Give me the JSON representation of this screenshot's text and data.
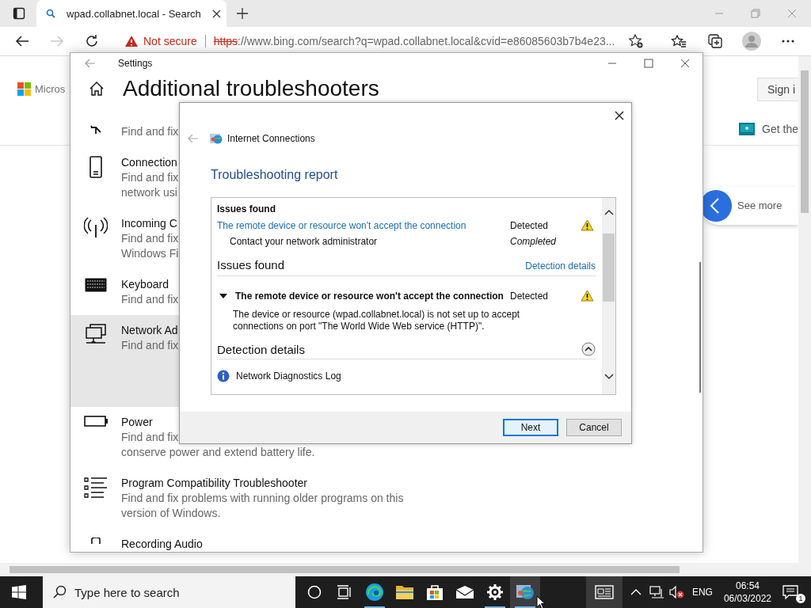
{
  "browser": {
    "tabs": [
      {
        "title": "wpad.collabnet.local - Search",
        "selected": true
      }
    ],
    "security": "Not secure",
    "url_scheme": "https",
    "url_rest": "://www.bing.com/search?q=wpad.collabnet.local&cvid=e86085603b7b4e23..."
  },
  "page": {
    "logo_text": "Micros",
    "sign_in": "Sign i",
    "promo": "Get the",
    "see_more": "See more"
  },
  "settings": {
    "title": "Settings",
    "heading": "Additional troubleshooters",
    "items": [
      {
        "lines": [
          "Find and fix"
        ],
        "selected": false
      },
      {
        "title": "Connection",
        "lines": [
          "Find and fix",
          "network usi"
        ],
        "selected": false
      },
      {
        "title": "Incoming C",
        "lines": [
          "Find and fix",
          "Windows Fi"
        ],
        "selected": false
      },
      {
        "title": "Keyboard",
        "lines": [
          "Find and fix"
        ],
        "selected": false
      },
      {
        "title": "Network Ad",
        "lines": [
          "Find and fix"
        ],
        "selected": true
      },
      {
        "title": "Power",
        "lines": [
          "Find and fix",
          "conserve power and extend battery life."
        ],
        "selected": false
      },
      {
        "title": "Program Compatibility Troubleshooter",
        "lines": [
          "Find and fix problems with running older programs on this",
          "version of Windows."
        ],
        "selected": false
      },
      {
        "title": "Recording Audio",
        "selected": false
      }
    ]
  },
  "dialog": {
    "title": "Internet Connections",
    "heading": "Troubleshooting report",
    "summary": {
      "heading": "Issues found",
      "issue": {
        "text": "The remote device or resource won't accept the connection",
        "status": "Detected"
      },
      "step": {
        "text": "Contact your network administrator",
        "status": "Completed"
      }
    },
    "issues": {
      "heading": "Issues found",
      "link": "Detection details",
      "items": [
        {
          "title": "The remote device or resource won't accept the connection",
          "status": "Detected",
          "expanded": true,
          "description": "The device or resource (wpad.collabnet.local) is not set up to accept connections on port \"The World Wide Web service (HTTP)\"."
        }
      ]
    },
    "details": {
      "heading": "Detection details",
      "expanded": true,
      "log": "Network Diagnostics Log"
    },
    "buttons": [
      {
        "label": "Next",
        "default": true
      },
      {
        "label": "Cancel",
        "default": false
      }
    ]
  },
  "taskbar": {
    "search_placeholder": "Type here to search",
    "apps": [
      {
        "running": false,
        "active": false
      },
      {
        "running": false,
        "active": false
      },
      {
        "running": true,
        "active": false
      },
      {
        "running": false,
        "active": false
      },
      {
        "running": false,
        "active": false
      },
      {
        "running": false,
        "active": false
      },
      {
        "running": true,
        "active": false
      },
      {
        "running": true,
        "active": true
      }
    ],
    "language": "ENG",
    "time": "06:54",
    "date": "06/03/2022",
    "notifications": "1"
  }
}
